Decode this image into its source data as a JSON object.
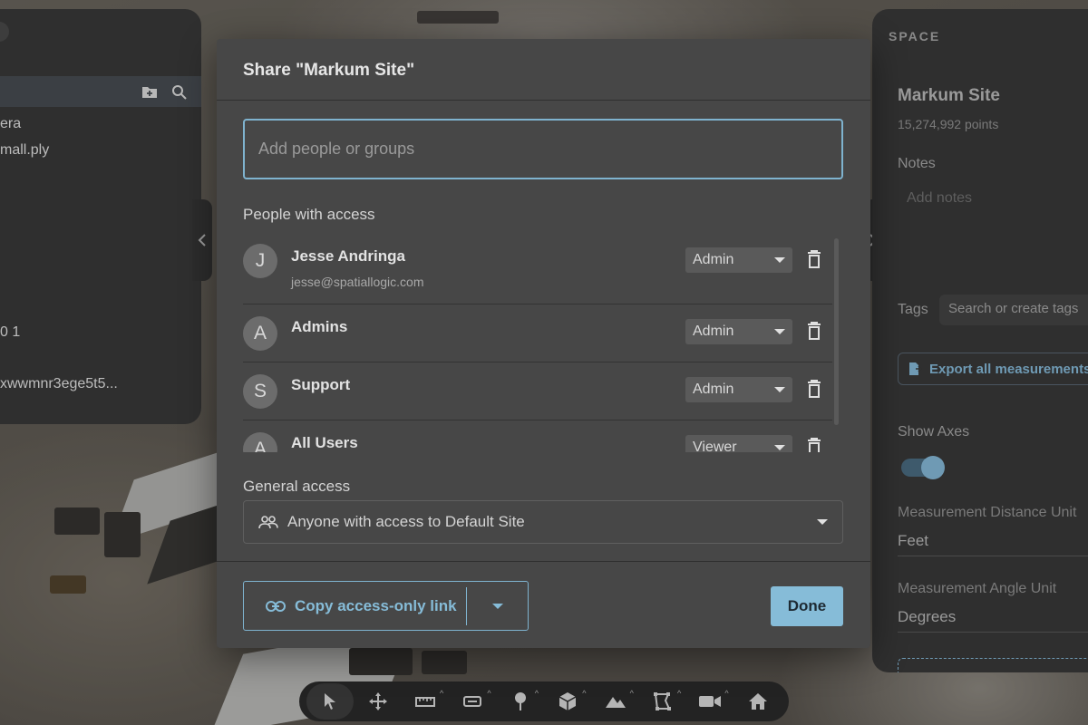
{
  "left_panel": {
    "items": [
      "era",
      "mall.ply",
      "0 1",
      "xwwmnr3ege5t5..."
    ]
  },
  "right_panel": {
    "section": "SPACE",
    "title": "Markum Site",
    "points": "15,274,992 points",
    "notes_label": "Notes",
    "notes_placeholder": "Add notes",
    "tags_label": "Tags",
    "tags_placeholder": "Search or create tags",
    "export_label": "Export all measurements",
    "show_axes_label": "Show Axes",
    "show_axes_on": true,
    "distance_unit_label": "Measurement Distance Unit",
    "distance_unit_value": "Feet",
    "angle_unit_label": "Measurement Angle Unit",
    "angle_unit_value": "Degrees"
  },
  "modal": {
    "title": "Share \"Markum Site\"",
    "add_placeholder": "Add people or groups",
    "people_label": "People with access",
    "people": [
      {
        "initial": "J",
        "name": "Jesse Andringa",
        "email": "jesse@spatiallogic.com",
        "role": "Admin"
      },
      {
        "initial": "A",
        "name": "Admins",
        "email": "",
        "role": "Admin"
      },
      {
        "initial": "S",
        "name": "Support",
        "email": "",
        "role": "Admin"
      },
      {
        "initial": "A",
        "name": "All Users",
        "email": "",
        "role": "Viewer"
      }
    ],
    "general_label": "General access",
    "general_value": "Anyone with access to Default Site",
    "copy_link_label": "Copy access-only link",
    "done_label": "Done"
  },
  "toolbar": {
    "tools": [
      "select-icon",
      "move-icon",
      "measure-icon",
      "area-icon",
      "pin-icon",
      "box-icon",
      "terrain-icon",
      "polygon-icon",
      "camera-icon",
      "home-icon"
    ]
  },
  "colors": {
    "accent": "#86bcd8",
    "modal_bg": "#474747",
    "panel_bg": "#2f2f2f"
  }
}
